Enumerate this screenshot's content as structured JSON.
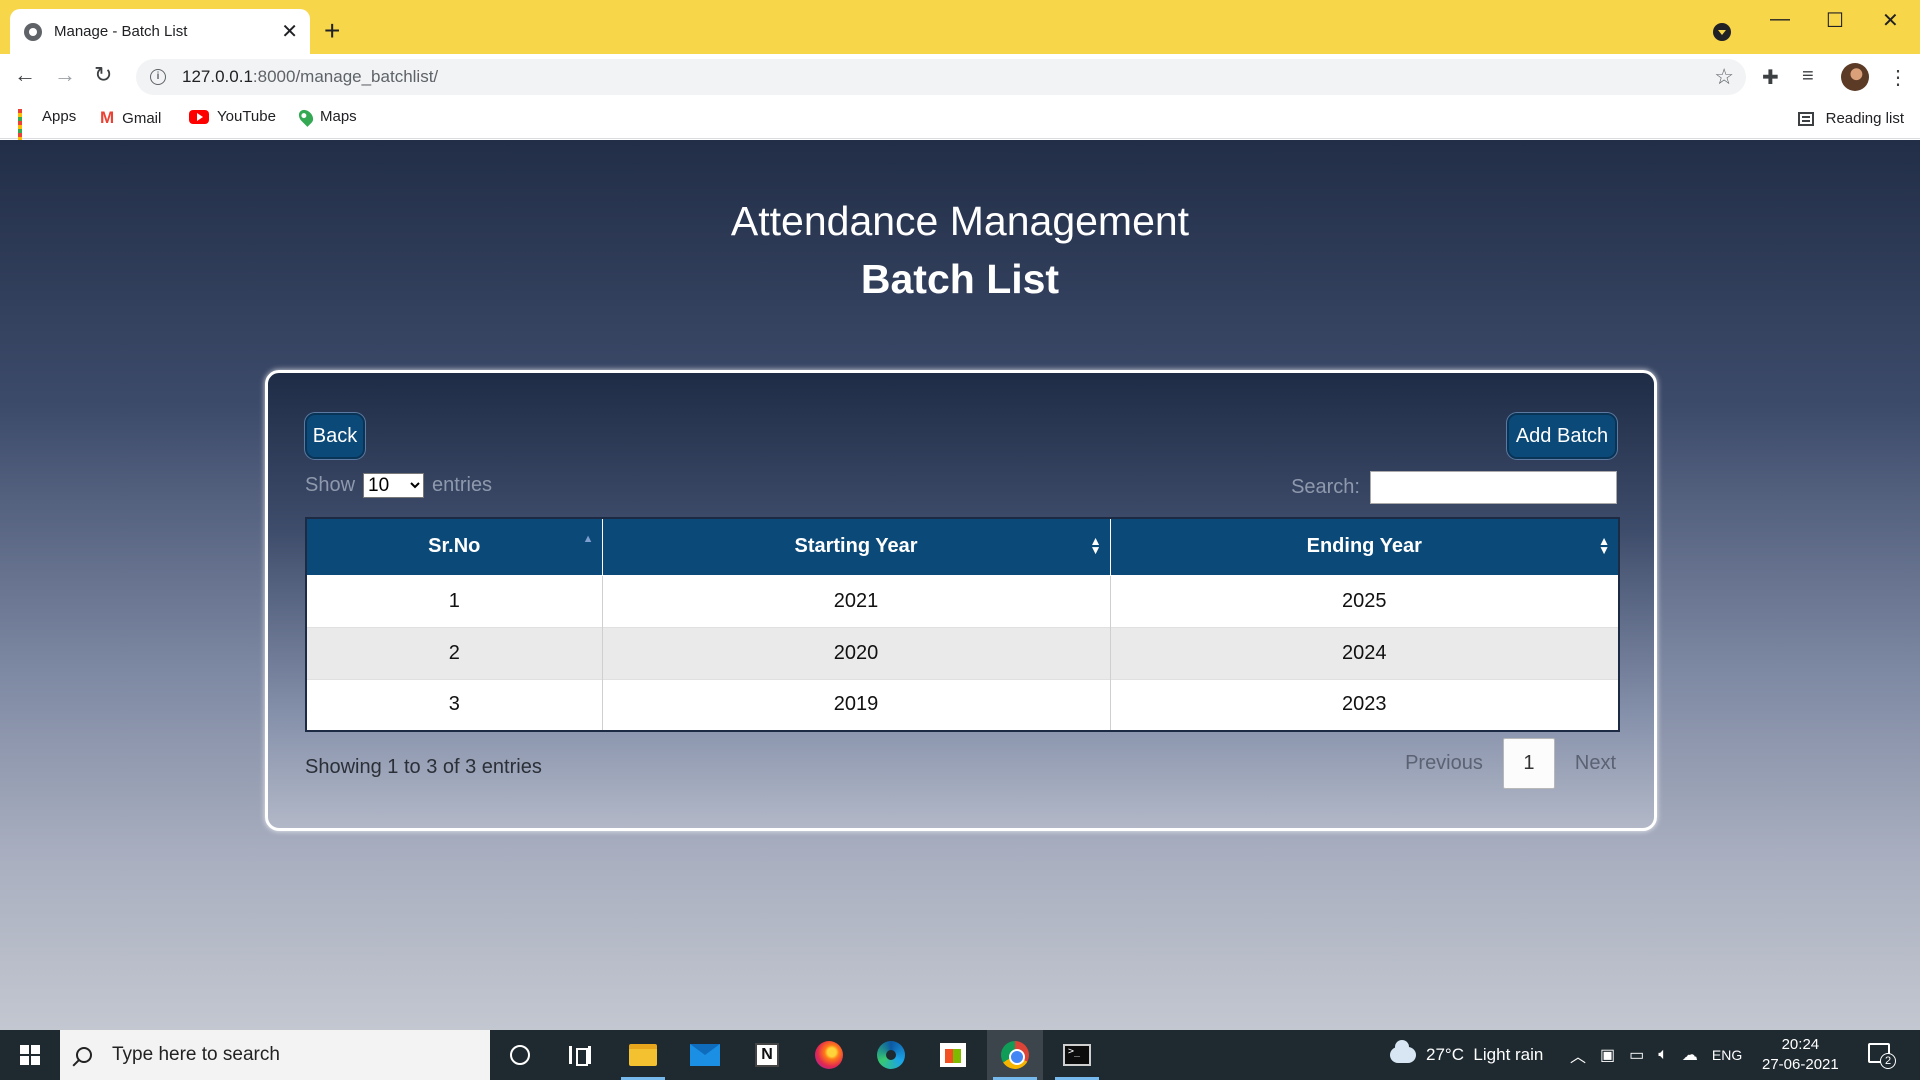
{
  "browser": {
    "tab_title": "Manage - Batch List",
    "url_host": "127.0.0.1",
    "url_rest": ":8000/manage_batchlist/",
    "bookmarks": [
      "Apps",
      "Gmail",
      "YouTube",
      "Maps"
    ],
    "reading_list": "Reading list",
    "tab_bar_color": "#f7d64a"
  },
  "page": {
    "app_title": "Attendance Management",
    "title": "Batch List",
    "back_label": "Back",
    "add_label": "Add Batch",
    "show_label": "Show",
    "entries_label": "entries",
    "page_length": "10",
    "search_label": "Search:",
    "search_value": "",
    "columns": [
      "Sr.No",
      "Starting Year",
      "Ending Year"
    ],
    "rows": [
      [
        "1",
        "2021",
        "2025"
      ],
      [
        "2",
        "2020",
        "2024"
      ],
      [
        "3",
        "2019",
        "2023"
      ]
    ],
    "info": "Showing 1 to 3 of 3 entries",
    "previous_label": "Previous",
    "current_page": "1",
    "next_label": "Next",
    "header_color": "#0b4a78"
  },
  "taskbar": {
    "search_placeholder": "Type here to search",
    "weather": "27°C  Light rain",
    "language": "ENG",
    "time": "20:24",
    "date": "27-06-2021",
    "notification_count": "2"
  }
}
